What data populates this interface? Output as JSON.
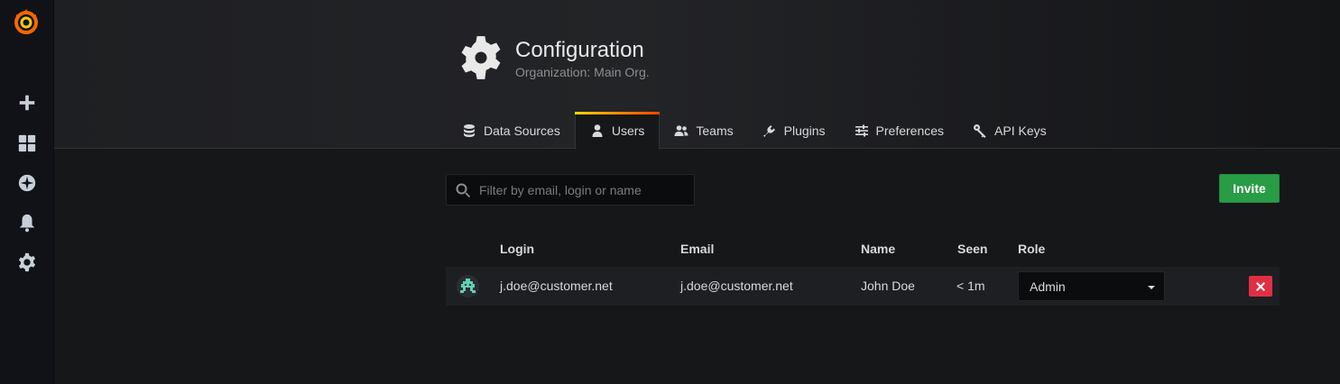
{
  "sidebar": {
    "logo": "grafana-logo",
    "items": [
      {
        "icon": "plus-icon",
        "name": "create"
      },
      {
        "icon": "dashboards-icon",
        "name": "dashboards"
      },
      {
        "icon": "compass-icon",
        "name": "explore"
      },
      {
        "icon": "bell-icon",
        "name": "alerting"
      },
      {
        "icon": "gear-icon",
        "name": "configuration"
      }
    ]
  },
  "header": {
    "icon": "gear-icon",
    "title": "Configuration",
    "subtitle": "Organization: Main Org."
  },
  "tabs": [
    {
      "label": "Data Sources",
      "icon": "database-icon",
      "active": false
    },
    {
      "label": "Users",
      "icon": "user-icon",
      "active": true
    },
    {
      "label": "Teams",
      "icon": "users-icon",
      "active": false
    },
    {
      "label": "Plugins",
      "icon": "plug-icon",
      "active": false
    },
    {
      "label": "Preferences",
      "icon": "sliders-icon",
      "active": false
    },
    {
      "label": "API Keys",
      "icon": "key-icon",
      "active": false
    }
  ],
  "search": {
    "placeholder": "Filter by email, login or name",
    "value": ""
  },
  "invite_label": "Invite",
  "table": {
    "columns": [
      "Login",
      "Email",
      "Name",
      "Seen",
      "Role"
    ],
    "rows": [
      {
        "login": "j.doe@customer.net",
        "email": "j.doe@customer.net",
        "name": "John Doe",
        "seen": "< 1m",
        "role": "Admin"
      }
    ]
  },
  "colors": {
    "accent_gradient": [
      "#ffd500",
      "#ff4400"
    ],
    "invite": "#299c46",
    "delete": "#e02f44"
  }
}
